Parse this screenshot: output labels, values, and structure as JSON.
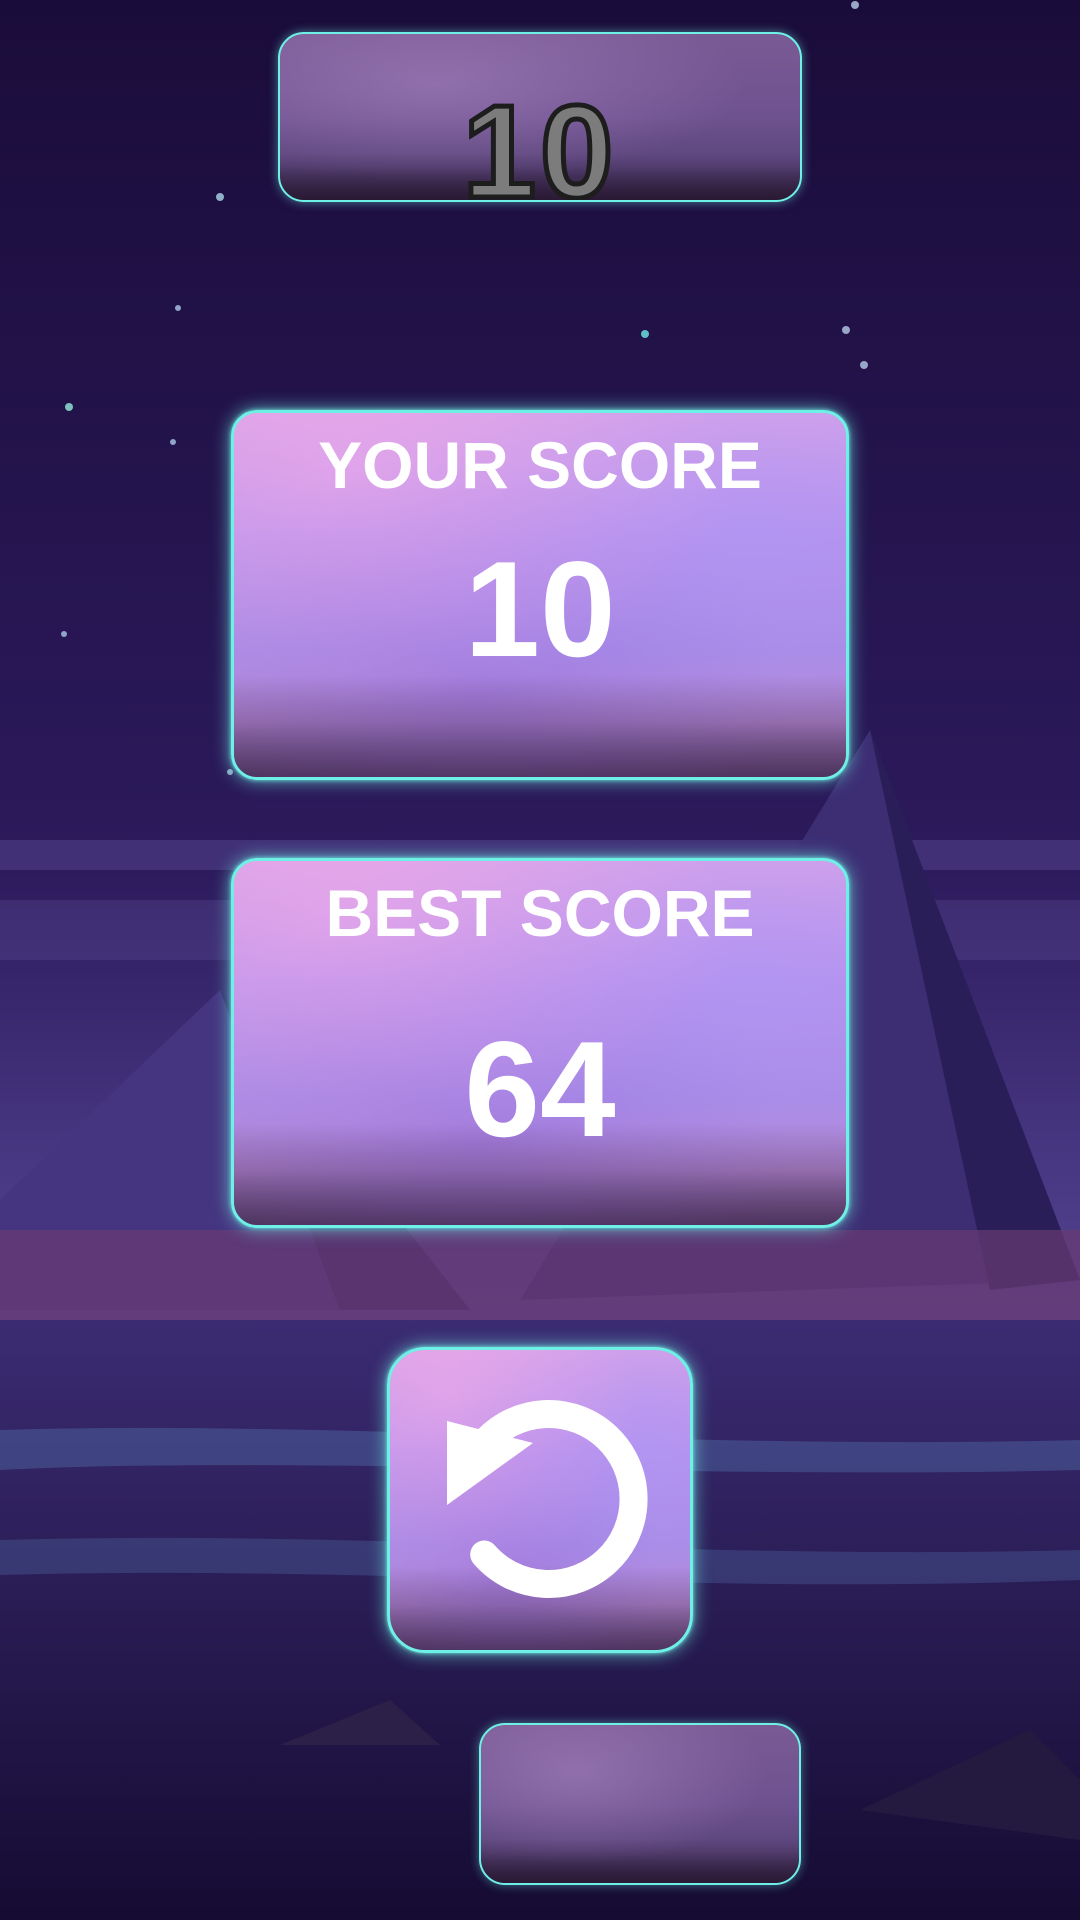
{
  "hud": {
    "current_score": "10"
  },
  "your_score_card": {
    "title": "YOUR SCORE",
    "value": "10"
  },
  "best_score_card": {
    "title": "BEST SCORE",
    "value": "64"
  },
  "restart_button": {
    "icon": "restart-icon"
  },
  "colors": {
    "panel_glow": "#6ff0e6",
    "text": "#ffffff",
    "sky": "#1a0f3a"
  }
}
